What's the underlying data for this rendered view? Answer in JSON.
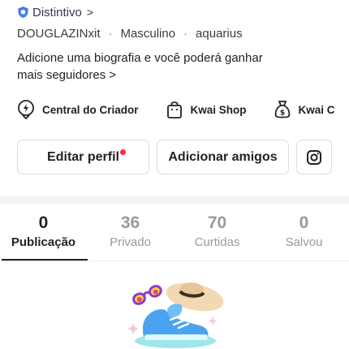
{
  "profile": {
    "badge_label": "Distintivo",
    "badge_chevron": ">",
    "username": "DOUGLAZINxit",
    "separator": "·",
    "gender": "Masculino",
    "sign": "aquarius",
    "bio_line1": "Adicione uma biografia e você poderá ganhar",
    "bio_line2": "mais seguidores",
    "bio_chevron": ">"
  },
  "shortcuts": [
    {
      "label": "Central do Criador",
      "icon": "lightning-pin-icon"
    },
    {
      "label": "Kwai Shop",
      "icon": "shopping-bag-icon"
    },
    {
      "label": "Kwai C",
      "icon": "money-bag-icon"
    }
  ],
  "actions": {
    "edit_profile": "Editar perfil",
    "add_friends": "Adicionar amigos",
    "instagram_icon": "instagram-icon"
  },
  "tabs": [
    {
      "count": "0",
      "label": "Publicação",
      "active": true
    },
    {
      "count": "36",
      "label": "Privado",
      "active": false
    },
    {
      "count": "70",
      "label": "Curtidas",
      "active": false
    },
    {
      "count": "0",
      "label": "Salvou",
      "active": false
    }
  ],
  "colors": {
    "badge_blue": "#4a7bf0",
    "notification_red": "#ff2b3a",
    "text_dark": "#222222",
    "text_muted": "#9a9a9a"
  }
}
